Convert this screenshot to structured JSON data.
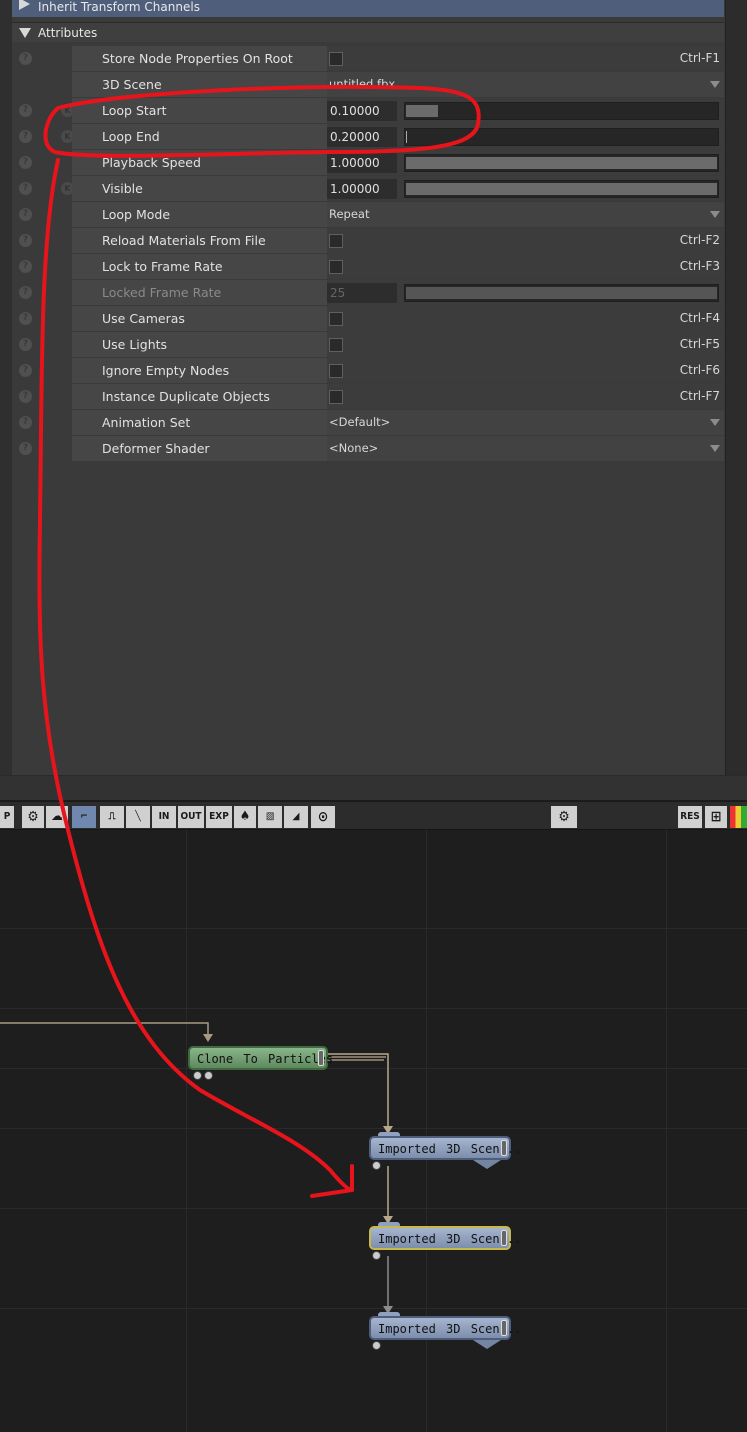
{
  "panel": {
    "inherit_header": "Inherit Transform Channels",
    "attributes_header": "Attributes",
    "rows": [
      {
        "label": "Store Node Properties On Root",
        "shortcut": "Ctrl-F1"
      },
      {
        "label": "3D Scene",
        "value": "untitled.fbx"
      },
      {
        "label": "Loop Start",
        "value": "0.10000",
        "slider": 0.1
      },
      {
        "label": "Loop End",
        "value": "0.20000",
        "slider": 0.0
      },
      {
        "label": "Playback Speed",
        "value": "1.00000",
        "slider": 1.0
      },
      {
        "label": "Visible",
        "value": "1.00000",
        "slider": 1.0
      },
      {
        "label": "Loop Mode",
        "value": "Repeat"
      },
      {
        "label": "Reload Materials From File",
        "shortcut": "Ctrl-F2"
      },
      {
        "label": "Lock to Frame Rate",
        "shortcut": "Ctrl-F3"
      },
      {
        "label": "Locked Frame Rate",
        "value": "25",
        "slider": 1.0
      },
      {
        "label": "Use Cameras",
        "shortcut": "Ctrl-F4"
      },
      {
        "label": "Use Lights",
        "shortcut": "Ctrl-F5"
      },
      {
        "label": "Ignore Empty Nodes",
        "shortcut": "Ctrl-F6"
      },
      {
        "label": "Instance Duplicate Objects",
        "shortcut": "Ctrl-F7"
      },
      {
        "label": "Animation Set",
        "value": "<Default>"
      },
      {
        "label": "Deformer Shader",
        "value": "<None>"
      }
    ],
    "icon_q": "?",
    "icon_k": "K",
    "icon_l": "L"
  },
  "toolbar": {
    "p": "P",
    "in": "IN",
    "out": "OUT",
    "exp": "EXP",
    "res": "RES"
  },
  "graph": {
    "clone_node": "Clone To Particles",
    "imported_1": "Imported 3D Scen...",
    "imported_2": "Imported 3D Scen...",
    "imported_3": "Imported 3D Scen..."
  },
  "colors": {
    "header_blue": "#4f5f7b",
    "annotation_red": "#e8141b",
    "node_green": "#6e9a6e",
    "node_blue": "#8d9ebc",
    "selected_outline": "#c8b84a"
  }
}
